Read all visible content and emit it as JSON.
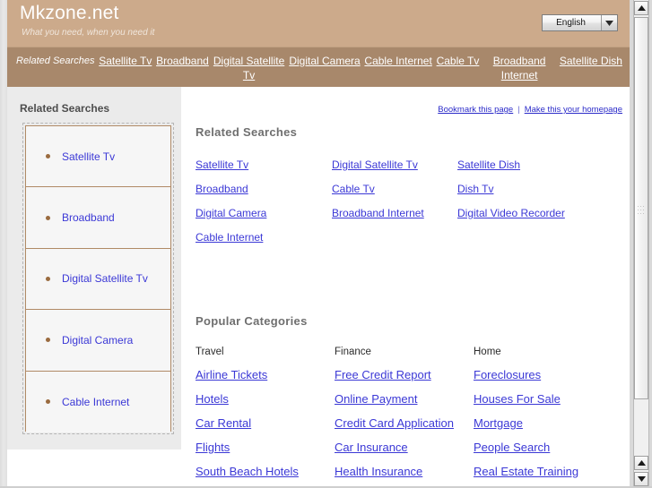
{
  "header": {
    "brand_title": "Mkzone.net",
    "tagline": "What you need, when you need it",
    "language_value": "English",
    "language_arrow_icon": "chevron-down-icon"
  },
  "nav": {
    "label": "Related Searches",
    "items": [
      {
        "label": "Satellite Tv"
      },
      {
        "label": "Broadband"
      },
      {
        "label": "Digital Satellite Tv"
      },
      {
        "label": "Digital Camera"
      },
      {
        "label": "Cable Internet"
      },
      {
        "label": "Cable Tv"
      },
      {
        "label": "Broadband Internet"
      },
      {
        "label": "Satellite Dish"
      }
    ]
  },
  "sidebar": {
    "title": "Related Searches",
    "bullet_icon": "bullet-dot-icon",
    "items": [
      {
        "label": "Satellite Tv"
      },
      {
        "label": "Broadband"
      },
      {
        "label": "Digital Satellite Tv"
      },
      {
        "label": "Digital Camera"
      },
      {
        "label": "Cable Internet"
      }
    ]
  },
  "main": {
    "bookmark_label": "Bookmark this page",
    "separator": "|",
    "homepage_label": "Make this your homepage",
    "related_searches": {
      "heading": "Related Searches",
      "links": [
        "Satellite Tv",
        "Digital Satellite Tv",
        "Satellite Dish",
        "Broadband",
        "Cable Tv",
        "Dish Tv",
        "Digital Camera",
        "Broadband Internet",
        "Digital Video Recorder",
        "Cable Internet"
      ]
    },
    "popular_categories": {
      "heading": "Popular Categories",
      "columns": [
        {
          "title": "Travel",
          "links": [
            "Airline Tickets",
            "Hotels",
            "Car Rental",
            "Flights",
            "South Beach Hotels"
          ]
        },
        {
          "title": "Finance",
          "links": [
            "Free Credit Report",
            "Online Payment",
            "Credit Card Application",
            "Car Insurance",
            "Health Insurance"
          ]
        },
        {
          "title": "Home",
          "links": [
            "Foreclosures",
            "Houses For Sale",
            "Mortgage",
            "People Search",
            "Real Estate Training"
          ]
        }
      ]
    }
  },
  "scrollbar": {
    "up_arrow_icon": "triangle-up-icon",
    "down_arrow_icon": "triangle-down-icon"
  },
  "colors": {
    "header_bg": "#ccaa8b",
    "nav_bg": "#a8886b",
    "sidebar_bg": "#ebebeb",
    "link": "#3b38d6",
    "heading": "#6f6f6f",
    "box_border": "#b08a66"
  }
}
